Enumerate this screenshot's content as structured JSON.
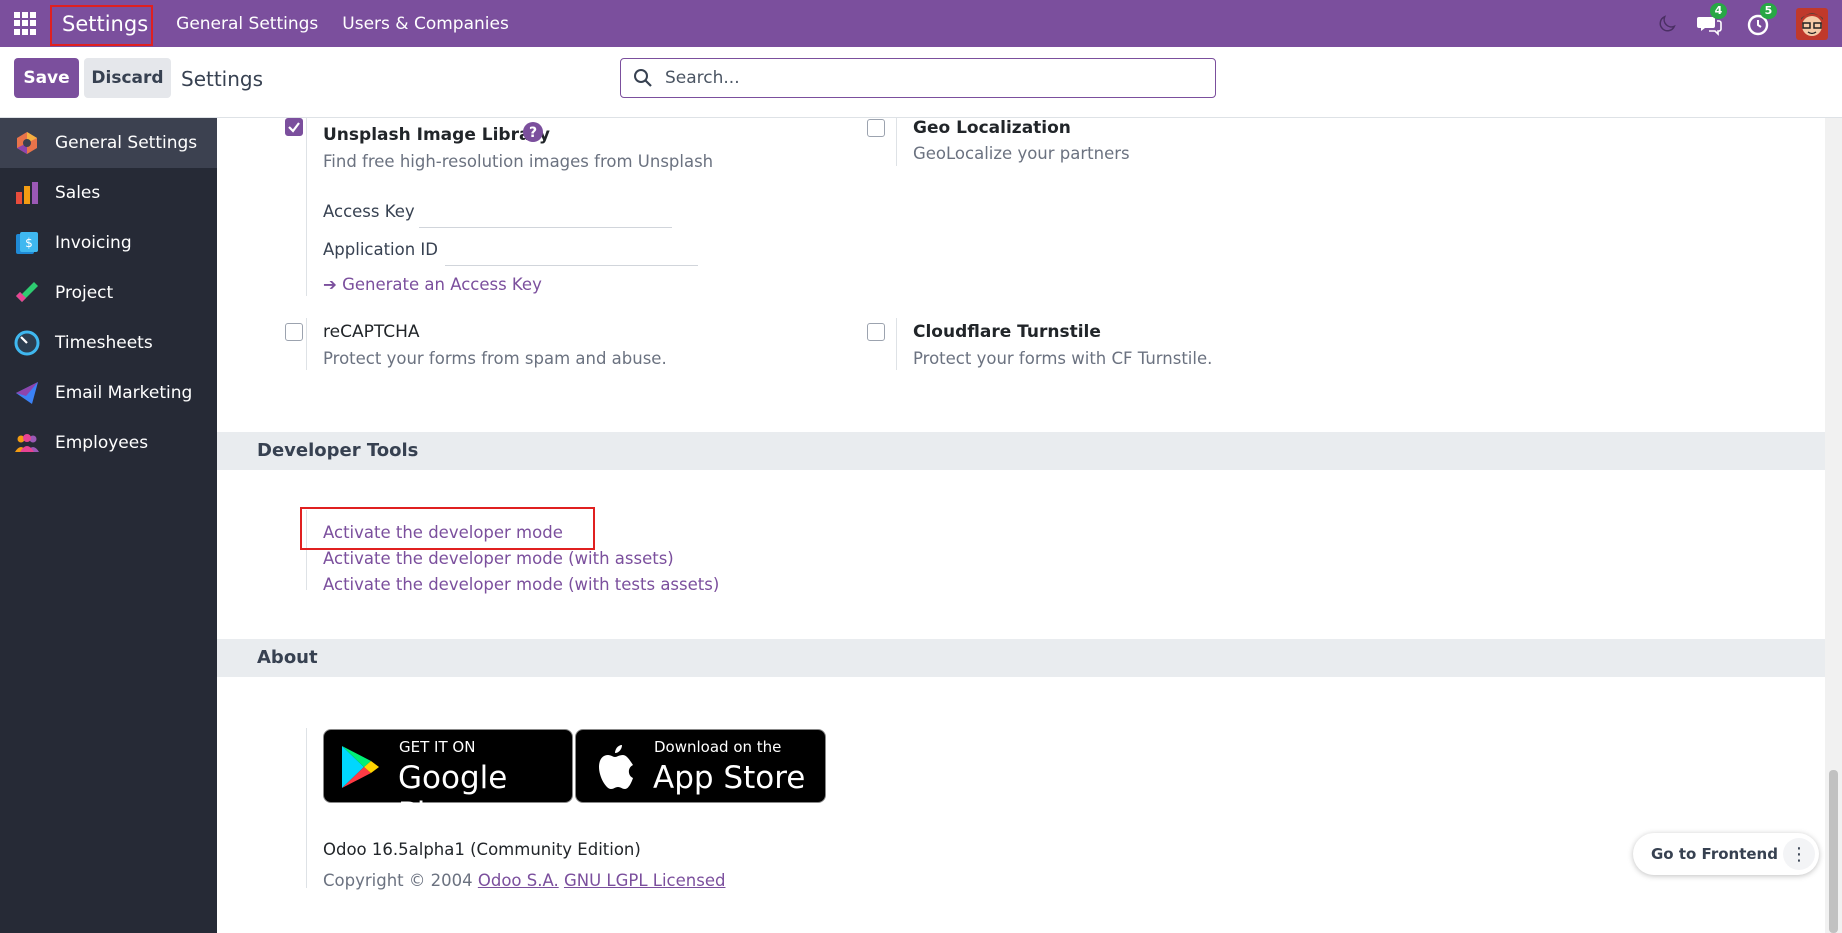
{
  "navbar": {
    "brand": "Settings",
    "menu": [
      "General Settings",
      "Users & Companies"
    ],
    "messages_count": "4",
    "activities_count": "5"
  },
  "control_panel": {
    "save_label": "Save",
    "discard_label": "Discard",
    "title": "Settings",
    "search_placeholder": "Search..."
  },
  "sidebar": {
    "items": [
      {
        "label": "General Settings",
        "icon": "general-settings-icon",
        "active": true
      },
      {
        "label": "Sales",
        "icon": "sales-icon"
      },
      {
        "label": "Invoicing",
        "icon": "invoicing-icon"
      },
      {
        "label": "Project",
        "icon": "project-icon"
      },
      {
        "label": "Timesheets",
        "icon": "timesheets-icon"
      },
      {
        "label": "Email Marketing",
        "icon": "email-marketing-icon"
      },
      {
        "label": "Employees",
        "icon": "employees-icon"
      }
    ]
  },
  "settings": {
    "unsplash": {
      "title": "Unsplash Image Library",
      "desc": "Find free high-resolution images from Unsplash",
      "checked": true,
      "access_key_label": "Access Key",
      "application_id_label": "Application ID",
      "generate_link": "➔ Generate an Access Key"
    },
    "geo": {
      "title": "Geo Localization",
      "desc": "GeoLocalize your partners",
      "checked": false
    },
    "recaptcha": {
      "title": "reCAPTCHA",
      "desc": "Protect your forms from spam and abuse.",
      "checked": false
    },
    "turnstile": {
      "title": "Cloudflare Turnstile",
      "desc": "Protect your forms with CF Turnstile.",
      "checked": false
    }
  },
  "developer_tools": {
    "heading": "Developer Tools",
    "links": [
      "Activate the developer mode",
      "Activate the developer mode (with assets)",
      "Activate the developer mode (with tests assets)"
    ]
  },
  "about": {
    "heading": "About",
    "google_play_small": "GET IT ON",
    "google_play_big": "Google Play",
    "app_store_small": "Download on the",
    "app_store_big": "App Store",
    "version": "Odoo 16.5alpha1 (Community Edition)",
    "copyright_prefix": "Copyright © 2004",
    "company_link": "Odoo S.A.",
    "license_link": "GNU LGPL Licensed"
  },
  "floating": {
    "go_frontend": "Go to Frontend",
    "more": "⋮"
  },
  "colors": {
    "brand": "#7b4f9d",
    "sidebar": "#262a36",
    "badge": "#28a745",
    "highlight": "#e02020"
  }
}
